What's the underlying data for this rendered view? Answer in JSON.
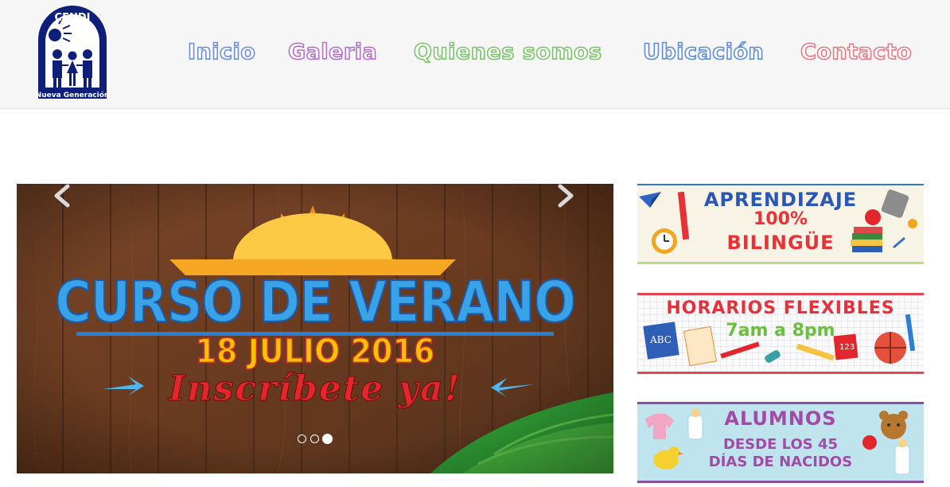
{
  "header": {
    "logo": {
      "top_text": "CENDI",
      "bottom_text": "Nueva Generación"
    },
    "nav": [
      "Inicio",
      "Galeria",
      "Quienes somos",
      "Ubicación",
      "Contacto"
    ]
  },
  "slider": {
    "title": "CURSO DE VERANO",
    "date": "18 JULIO 2016",
    "cta": "Inscríbete ya!",
    "prev_icon": "chevron-left-icon",
    "next_icon": "chevron-right-icon",
    "dots_total": 3,
    "active_dot": 3
  },
  "banners": [
    {
      "lines": [
        "APRENDIZAJE",
        "100%",
        "BILINGÜE"
      ]
    },
    {
      "lines": [
        "HORARIOS  FLEXIBLES",
        "7am a 8pm"
      ],
      "icon_texts": [
        "ABC",
        "123"
      ]
    },
    {
      "lines": [
        "ALUMNOS",
        "DESDE LOS 45",
        "DÍAS DE NACIDOS"
      ]
    }
  ],
  "colors": {
    "logo_blue": "#0e1f7a",
    "inicio": "#6b8fd8",
    "galeria": "#b272c8",
    "quienes": "#7dc36b",
    "ubicacion": "#5f8fd3",
    "contacto": "#e57a86",
    "wood": "#6e3f22"
  }
}
